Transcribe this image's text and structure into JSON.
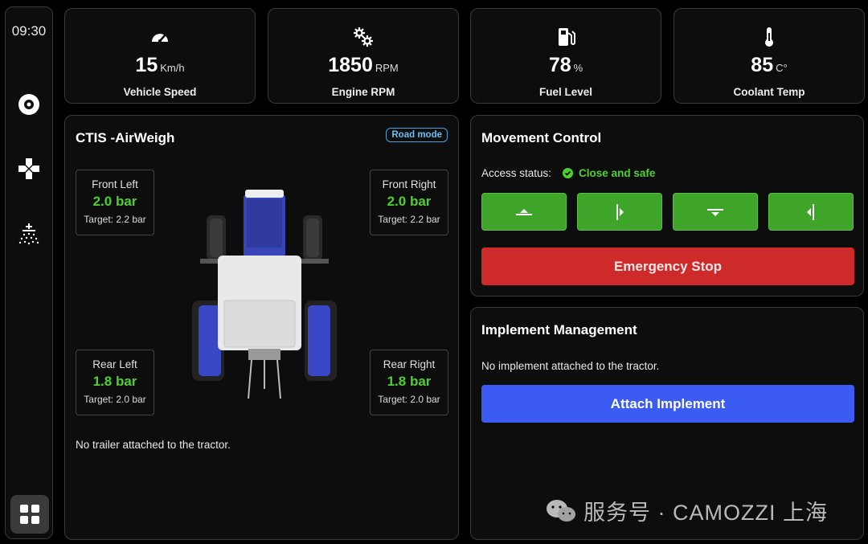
{
  "sidebar": {
    "clock": "09:30",
    "items": [
      {
        "icon": "tire-icon"
      },
      {
        "icon": "gamepad-icon"
      },
      {
        "icon": "sprayer-icon"
      }
    ],
    "apps_icon": "apps-grid-icon"
  },
  "stats": [
    {
      "icon": "speedometer-icon",
      "value": "15",
      "unit": "Km/h",
      "label": "Vehicle Speed"
    },
    {
      "icon": "gears-icon",
      "value": "1850",
      "unit": "RPM",
      "label": "Engine RPM"
    },
    {
      "icon": "fuel-pump-icon",
      "value": "78",
      "unit": "%",
      "label": "Fuel Level"
    },
    {
      "icon": "thermometer-icon",
      "value": "85",
      "unit": "C°",
      "label": "Coolant Temp"
    }
  ],
  "ctis": {
    "title": "CTIS -AirWeigh",
    "mode": "Road mode",
    "tires": [
      {
        "name": "Front Left",
        "value": "2.0 bar",
        "target": "Target: 2.2 bar"
      },
      {
        "name": "Front Right",
        "value": "2.0 bar",
        "target": "Target: 2.2 bar"
      },
      {
        "name": "Rear Left",
        "value": "1.8 bar",
        "target": "Target: 2.0 bar"
      },
      {
        "name": "Rear Right",
        "value": "1.8 bar",
        "target": "Target: 2.0 bar"
      }
    ],
    "trailer_note": "No trailer attached to the tractor."
  },
  "movement": {
    "title": "Movement Control",
    "access_label": "Access status:",
    "access_value": "Close and safe",
    "direction_buttons": [
      "move-up-icon",
      "move-right-icon",
      "move-down-icon",
      "move-left-icon"
    ],
    "emergency_label": "Emergency Stop"
  },
  "implement": {
    "title": "Implement Management",
    "note": "No implement attached to the tractor.",
    "attach_label": "Attach Implement"
  },
  "watermark": "服务号 · CAMOZZI 上海",
  "colors": {
    "green": "#3fa52a",
    "green_text": "#4cd12e",
    "red": "#cf2a2a",
    "blue": "#3b5bf2",
    "badge": "#4aa3e0"
  }
}
